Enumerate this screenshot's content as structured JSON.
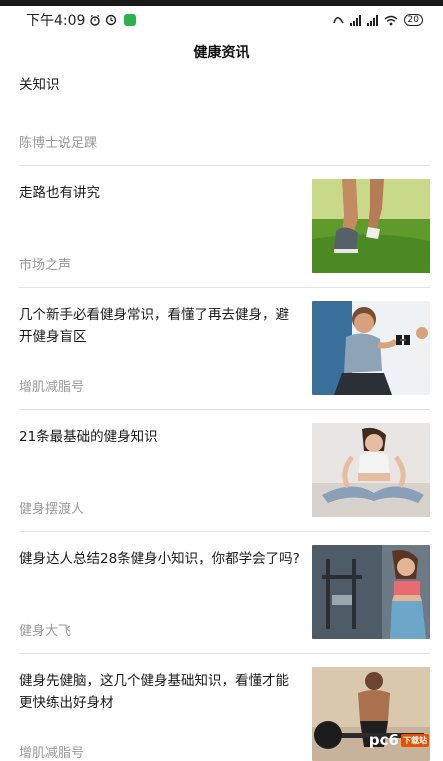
{
  "status_bar": {
    "time": "下午4:09",
    "battery": "20"
  },
  "header": {
    "title": "健康资讯"
  },
  "articles": [
    {
      "title": "关知识",
      "source": "陈博士说足踝",
      "has_image": false
    },
    {
      "title": "走路也有讲究",
      "source": "市场之声",
      "image_icon": "walking-legs-image"
    },
    {
      "title": "几个新手必看健身常识，看懂了再去健身，避开健身盲区",
      "source": "增肌减脂号",
      "image_icon": "dumbbell-workout-image"
    },
    {
      "title": "21条最基础的健身知识",
      "source": "健身摆渡人",
      "image_icon": "yoga-woman-image"
    },
    {
      "title": "健身达人总结28条健身小知识，你都学会了吗?",
      "source": "健身大飞",
      "image_icon": "gym-woman-image"
    },
    {
      "title": "健身先健脑，这几个健身基础知识，看懂才能更快练出好身材",
      "source": "增肌减脂号",
      "image_icon": "man-barbell-image"
    }
  ],
  "watermark": {
    "text": "pc6",
    "badge": "下载站"
  },
  "colors": {
    "accent_green": "#2bb24c",
    "divider": "#e2e2e2",
    "source_gray": "#9a9a9a"
  }
}
